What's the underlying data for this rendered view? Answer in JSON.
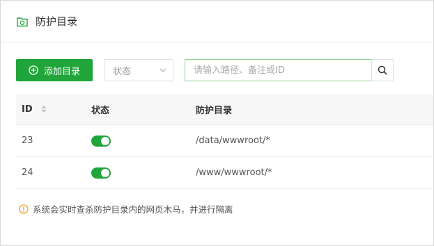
{
  "header": {
    "title": "防护目录",
    "icon": "folder-shield-icon"
  },
  "toolbar": {
    "add_label": "添加目录",
    "status_placeholder": "状态",
    "search_placeholder": "请输入路径、备注或ID"
  },
  "table": {
    "columns": {
      "id": "ID",
      "status": "状态",
      "path": "防护目录"
    },
    "rows": [
      {
        "id": "23",
        "enabled": true,
        "path": "/data/wwwroot/*"
      },
      {
        "id": "24",
        "enabled": true,
        "path": "/www/wwwroot/*"
      }
    ]
  },
  "tip": "系统会实时查杀防护目录内的网页木马，并进行隔离",
  "colors": {
    "accent": "#20a53a",
    "warning": "#f0a020"
  }
}
